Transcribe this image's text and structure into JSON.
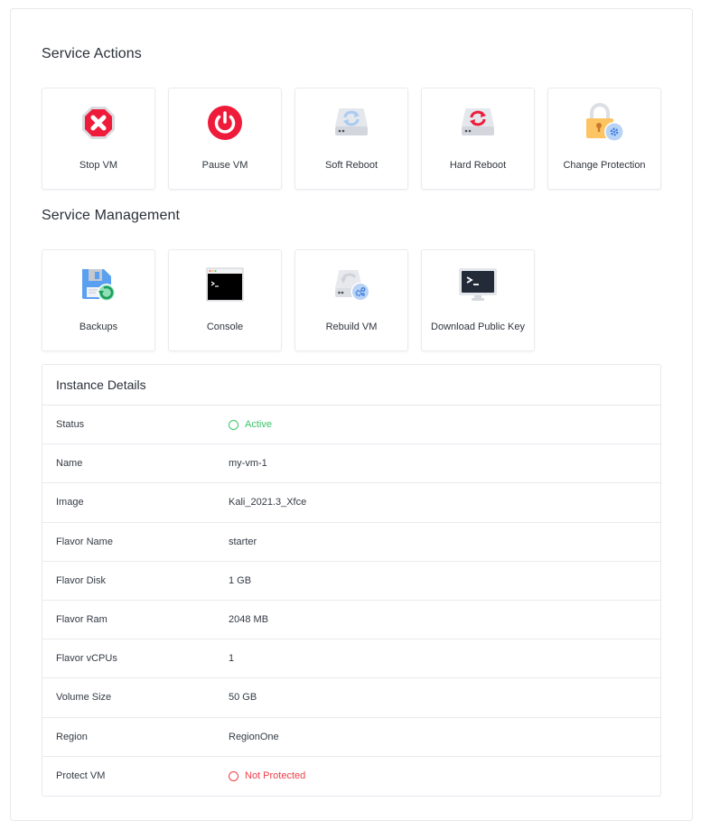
{
  "service_actions": {
    "title": "Service Actions",
    "items": [
      {
        "label": "Stop VM",
        "icon": "stop-octagon-icon"
      },
      {
        "label": "Pause VM",
        "icon": "power-icon"
      },
      {
        "label": "Soft Reboot",
        "icon": "soft-reboot-drive-icon"
      },
      {
        "label": "Hard Reboot",
        "icon": "hard-reboot-drive-icon"
      },
      {
        "label": "Change Protection",
        "icon": "lock-settings-icon"
      }
    ]
  },
  "service_management": {
    "title": "Service Management",
    "items": [
      {
        "label": "Backups",
        "icon": "floppy-restore-icon"
      },
      {
        "label": "Console",
        "icon": "terminal-window-icon"
      },
      {
        "label": "Rebuild VM",
        "icon": "drive-rebuild-icon"
      },
      {
        "label": "Download Public Key",
        "icon": "monitor-terminal-icon"
      }
    ]
  },
  "instance_details": {
    "title": "Instance Details",
    "rows": [
      {
        "key": "Status",
        "value": "Active",
        "status": "ok"
      },
      {
        "key": "Name",
        "value": "my-vm-1"
      },
      {
        "key": "Image",
        "value": "Kali_2021.3_Xfce"
      },
      {
        "key": "Flavor Name",
        "value": "starter"
      },
      {
        "key": "Flavor Disk",
        "value": "1 GB"
      },
      {
        "key": "Flavor Ram",
        "value": "2048 MB"
      },
      {
        "key": "Flavor vCPUs",
        "value": "1"
      },
      {
        "key": "Volume Size",
        "value": "50 GB"
      },
      {
        "key": "Region",
        "value": "RegionOne"
      },
      {
        "key": "Protect VM",
        "value": "Not Protected",
        "status": "bad"
      }
    ]
  },
  "colors": {
    "active": "#3ac46a",
    "not_protected": "#ef3e4a",
    "danger_red": "#ee1c3a"
  }
}
